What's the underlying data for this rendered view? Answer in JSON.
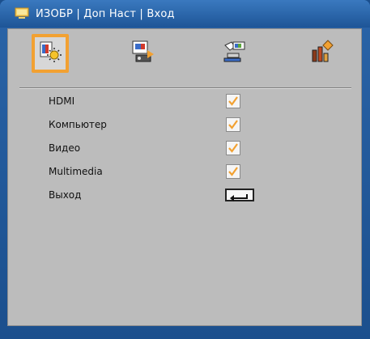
{
  "window": {
    "title": "ИЗОБР | Доп Наст | Вход"
  },
  "tabs": [
    {
      "icon": "picture-settings-icon",
      "active": true
    },
    {
      "icon": "screen-settings-icon",
      "active": false
    },
    {
      "icon": "setup-icon",
      "active": false
    },
    {
      "icon": "options-icon",
      "active": false
    }
  ],
  "menu": {
    "items": [
      {
        "label": "HDMI",
        "checked": true
      },
      {
        "label": "Компьютер",
        "checked": true
      },
      {
        "label": "Видео",
        "checked": true
      },
      {
        "label": "Multimedia",
        "checked": true
      }
    ],
    "exit_label": "Выход"
  },
  "colors": {
    "title_bar": "#1e5597",
    "panel": "#bcbcbc",
    "accent": "#f2a132",
    "check": "#f2a132"
  }
}
